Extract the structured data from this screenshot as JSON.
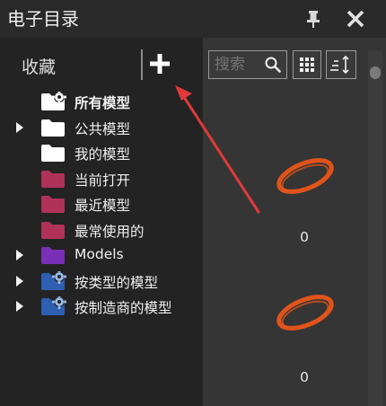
{
  "window": {
    "title": "电子目录",
    "pin_icon": "pin-icon",
    "close_icon": "close-icon"
  },
  "sidebar": {
    "section_label": "收藏",
    "add_icon": "plus-icon",
    "items": [
      {
        "label": "所有模型",
        "expandable": false,
        "icon": "folder-gear-icon",
        "color": "#ffffff",
        "bold": true
      },
      {
        "label": "公共模型",
        "expandable": true,
        "icon": "folder-icon",
        "color": "#ffffff",
        "bold": false
      },
      {
        "label": "我的模型",
        "expandable": false,
        "icon": "folder-icon",
        "color": "#ffffff",
        "bold": false
      },
      {
        "label": "当前打开",
        "expandable": false,
        "icon": "folder-icon",
        "color": "#b0325a",
        "bold": false
      },
      {
        "label": "最近模型",
        "expandable": false,
        "icon": "folder-icon",
        "color": "#b0325a",
        "bold": false
      },
      {
        "label": "最常使用的",
        "expandable": false,
        "icon": "folder-icon",
        "color": "#b0325a",
        "bold": false
      },
      {
        "label": "Models",
        "expandable": true,
        "icon": "folder-icon",
        "color": "#7a2fb8",
        "bold": false
      },
      {
        "label": "按类型的模型",
        "expandable": true,
        "icon": "folder-gear-icon",
        "color": "#2f5fb0",
        "bold": false
      },
      {
        "label": "按制造商的模型",
        "expandable": true,
        "icon": "folder-gear-icon",
        "color": "#2f5fb0",
        "bold": false
      }
    ]
  },
  "toolbar": {
    "search_placeholder": "搜索",
    "search_icon": "search-icon",
    "grid_icon": "grid-view-icon",
    "sort_icon": "sort-icon"
  },
  "content": {
    "models": [
      {
        "count": "0",
        "icon": "ring-model-icon",
        "color": "#e0541a"
      },
      {
        "count": "0",
        "icon": "ring-model-icon",
        "color": "#e0541a"
      }
    ]
  },
  "annotation": {
    "arrow_color": "#e03a3a"
  }
}
